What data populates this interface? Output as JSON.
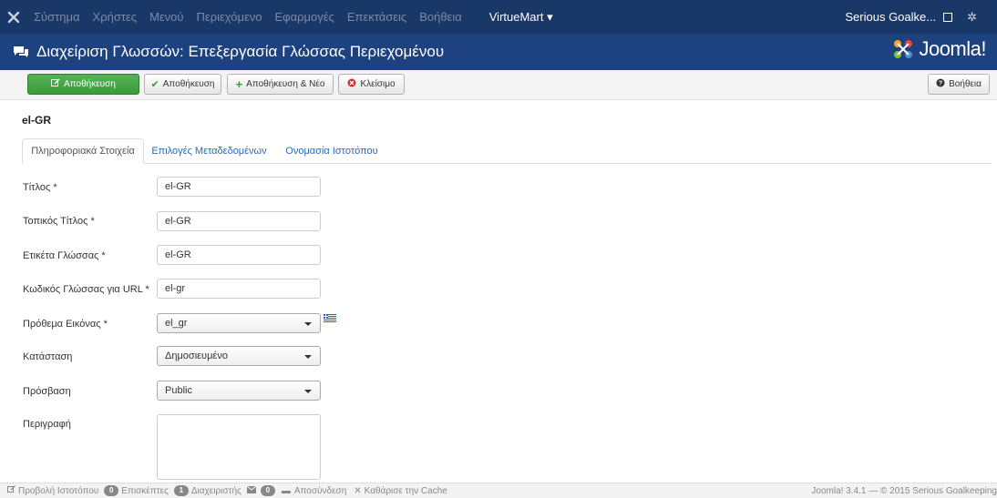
{
  "topnav": {
    "items": [
      "Σύστημα",
      "Χρήστες",
      "Μενού",
      "Περιεχόμενο",
      "Εφαρμογές",
      "Επεκτάσεις",
      "Βοήθεια"
    ],
    "virtuemart": "VirtueMart",
    "user": "Serious Goalke..."
  },
  "header": {
    "title": "Διαχείριση Γλωσσών: Επεξεργασία Γλώσσας Περιεχομένου",
    "brand": "Joomla!"
  },
  "toolbar": {
    "save_close": "Αποθήκευση",
    "save": "Αποθήκευση",
    "save_new": "Αποθήκευση & Νέο",
    "close": "Κλείσιμο",
    "help": "Βοήθεια"
  },
  "main": {
    "lang_code": "el-GR",
    "tabs": [
      "Πληροφοριακά Στοιχεία",
      "Επιλογές Μεταδεδομένων",
      "Ονομασία Ιστοτόπου"
    ],
    "fields": {
      "title": {
        "label": "Τίτλος *",
        "value": "el-GR"
      },
      "native_title": {
        "label": "Τοπικός Τίτλος *",
        "value": "el-GR"
      },
      "lang_tag": {
        "label": "Ετικέτα Γλώσσας *",
        "value": "el-GR"
      },
      "url_code": {
        "label": "Κωδικός Γλώσσας για URL *",
        "value": "el-gr"
      },
      "image_prefix": {
        "label": "Πρόθεμα Εικόνας *",
        "value": "el_gr"
      },
      "status": {
        "label": "Κατάσταση",
        "value": "Δημοσιευμένο"
      },
      "access": {
        "label": "Πρόσβαση",
        "value": "Public"
      },
      "description": {
        "label": "Περιγραφή",
        "value": ""
      }
    }
  },
  "footer": {
    "view_site": "Προβολή Ιστοτόπου",
    "visitors_count": "0",
    "visitors": "Επισκέπτες",
    "admins_count": "1",
    "admins": "Διαχειριστής",
    "messages_count": "0",
    "logout": "Αποσύνδεση",
    "clear_cache": "Καθάρισε την Cache",
    "copyright": "Joomla! 3.4.1 — © 2015 Serious Goalkeeping"
  },
  "colors": {
    "navbar": "#1a3867",
    "header": "#1e4180",
    "save_button": "#46a546",
    "link": "#2a69b8"
  }
}
